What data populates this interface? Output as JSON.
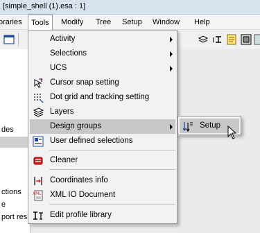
{
  "window": {
    "title": "[simple_shell (1).esa : 1]"
  },
  "menubar": {
    "items": [
      {
        "label": "oraries"
      },
      {
        "label": "Tools"
      },
      {
        "label": "Modify"
      },
      {
        "label": "Tree"
      },
      {
        "label": "Setup"
      },
      {
        "label": "Window"
      },
      {
        "label": "Help"
      }
    ]
  },
  "left_panel": {
    "rows": [
      {
        "label": "des"
      },
      {
        "label": "ctions"
      },
      {
        "label": "e"
      },
      {
        "label": "port res"
      }
    ]
  },
  "tools_menu": {
    "items": [
      {
        "label": "Activity",
        "icon": "none",
        "submenu": true
      },
      {
        "label": "Selections",
        "icon": "none",
        "submenu": true
      },
      {
        "label": "UCS",
        "icon": "none",
        "submenu": true
      },
      {
        "label": "Cursor snap setting",
        "icon": "cursor-snap-icon",
        "submenu": false
      },
      {
        "label": "Dot grid and tracking setting",
        "icon": "dot-grid-icon",
        "submenu": false
      },
      {
        "label": "Layers",
        "icon": "layers-icon",
        "submenu": false
      },
      {
        "label": "Design groups",
        "icon": "none",
        "submenu": true,
        "highlighted": true
      },
      {
        "label": "User defined selections",
        "icon": "user-selections-icon",
        "submenu": false
      },
      {
        "label": "Cleaner",
        "icon": "cleaner-icon",
        "submenu": false
      },
      {
        "label": "Coordinates info",
        "icon": "coordinates-icon",
        "submenu": false
      },
      {
        "label": "XML IO Document",
        "icon": "xml-document-icon",
        "submenu": false
      },
      {
        "label": "Edit profile library",
        "icon": "profile-library-icon",
        "submenu": false
      }
    ]
  },
  "design_groups_submenu": {
    "items": [
      {
        "label": "Setup",
        "icon": "design-groups-setup-icon"
      }
    ]
  },
  "colors": {
    "highlight": "#c8c8c8",
    "menu_bg": "#f2f2f2",
    "title_bg": "#d8e2ef"
  }
}
